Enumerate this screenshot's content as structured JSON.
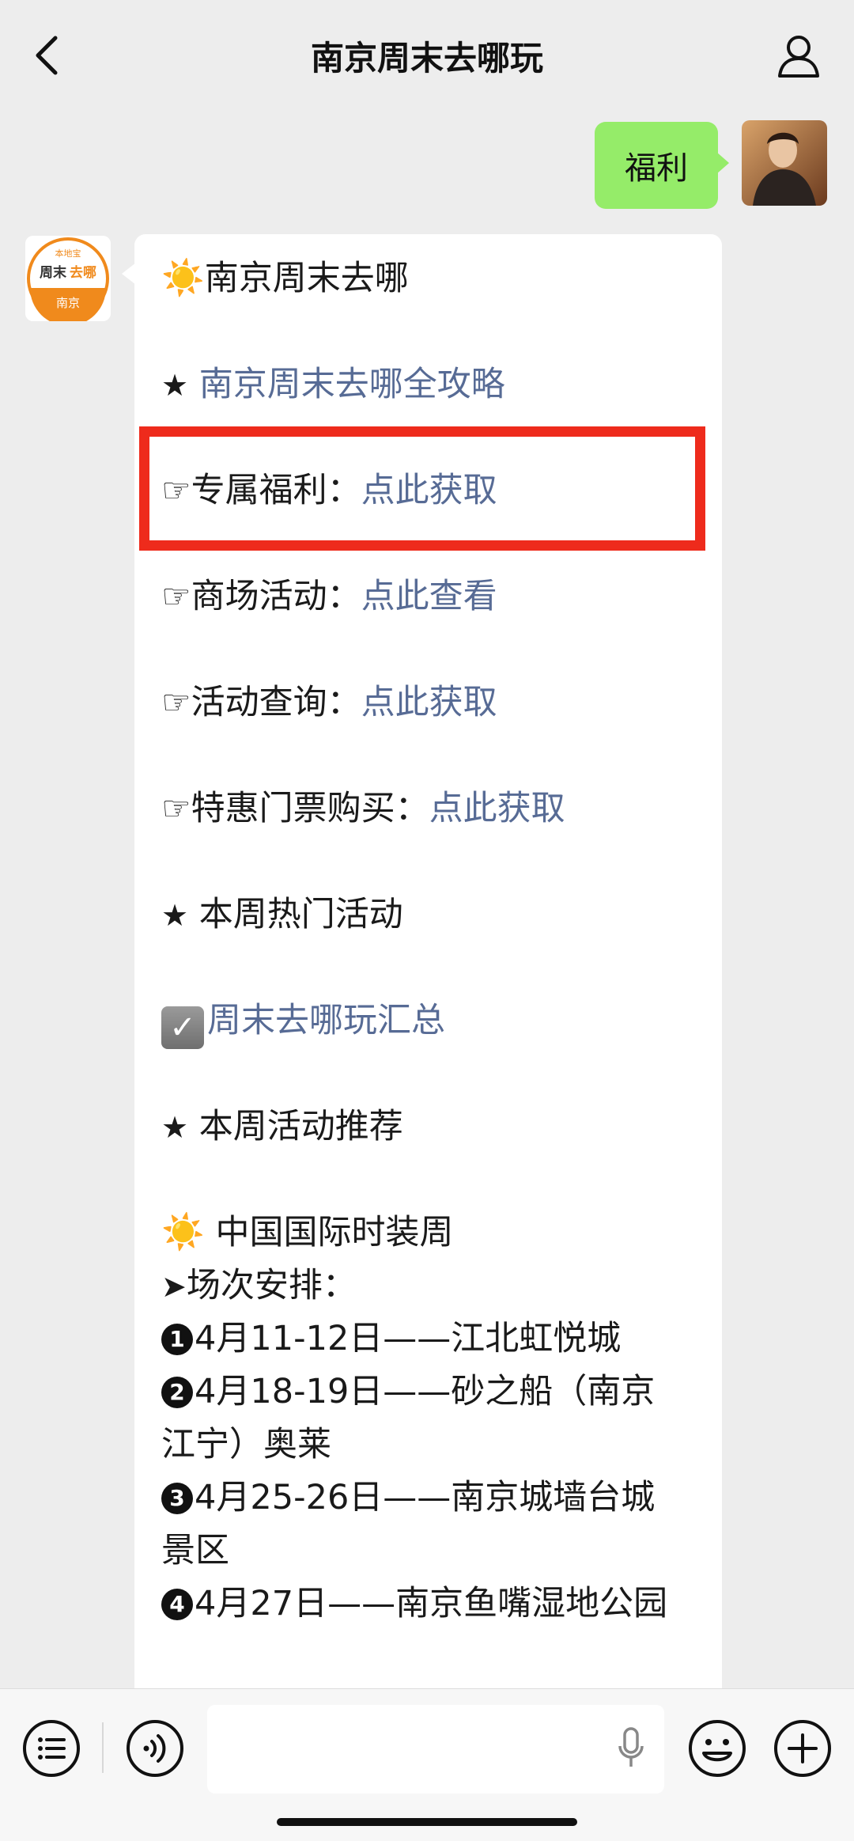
{
  "nav": {
    "title": "南京周末去哪玩"
  },
  "my_message": {
    "text": "福利"
  },
  "oa_avatar": {
    "badge_top": "本地宝",
    "brand_1": "周末",
    "brand_2": "去哪",
    "city": "南京"
  },
  "oa_message": {
    "line_title": "南京周末去哪",
    "line_guide": "南京周末去哪全攻略",
    "line_benefit_label": "专属福利：",
    "line_benefit_link": "点此获取",
    "line_mall_label": "商场活动：",
    "line_mall_link": "点此查看",
    "line_query_label": "活动查询：",
    "line_query_link": "点此获取",
    "line_ticket_label": "特惠门票购买：",
    "line_ticket_link": "点此获取",
    "line_hot": "本周热门活动",
    "line_summary": "周末去哪玩汇总",
    "line_recommend": "本周活动推荐",
    "line_event": "中国国际时装周",
    "line_schedule": "场次安排：",
    "sessions": [
      {
        "num": "1",
        "text": "4月11-12日——江北虹悦城"
      },
      {
        "num": "2",
        "text": "4月18-19日——砂之船（南京"
      },
      {
        "num": "",
        "text": "江宁）奥莱"
      },
      {
        "num": "3",
        "text": "4月25-26日——南京城墙台城"
      },
      {
        "num": "",
        "text": "景区"
      },
      {
        "num": "4",
        "text": "4月27日——南京鱼嘴湿地公园"
      }
    ]
  },
  "icons": {
    "back": "chevron-left-icon",
    "profile": "person-icon",
    "menu": "list-icon",
    "voice": "voice-icon",
    "mic": "microphone-icon",
    "emoji": "emoji-icon",
    "plus": "plus-icon"
  },
  "colors": {
    "link": "#576b95",
    "highlight": "#ee2b1c",
    "my_bubble": "#95ec69",
    "brand_orange": "#f08a1c"
  }
}
